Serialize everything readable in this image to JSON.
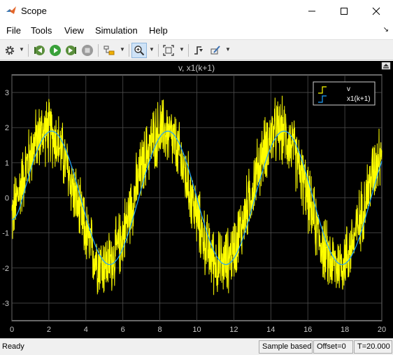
{
  "window": {
    "title": "Scope",
    "controls": [
      "minimize-icon",
      "maximize-icon",
      "close-icon"
    ]
  },
  "menu": {
    "items": [
      "File",
      "Tools",
      "View",
      "Simulation",
      "Help"
    ]
  },
  "toolbar": {
    "icons": [
      "gear-icon",
      "step-back-icon",
      "run-icon",
      "step-forward-icon",
      "stop-icon",
      "highlight-icon",
      "zoom-in-icon",
      "fit-to-view-icon",
      "triggers-icon",
      "brush-icon"
    ]
  },
  "chart_data": {
    "type": "line",
    "title": "v, x1(k+1)",
    "xlim": [
      0,
      20
    ],
    "ylim": [
      -3.5,
      3.5
    ],
    "x_ticks": [
      "0",
      "2",
      "4",
      "6",
      "8",
      "10",
      "12",
      "14",
      "16",
      "18",
      "20"
    ],
    "y_ticks": [
      "3",
      "2",
      "1",
      "0",
      "-1",
      "-2",
      "-3"
    ],
    "grid": true,
    "legend_position": "top-right",
    "background": "#000000",
    "series": [
      {
        "name": "v",
        "color": "#ffff00",
        "description_values": {
          "amplitude": 1.9,
          "period": 6.28,
          "noise_band": 0.7
        }
      },
      {
        "name": "x1(k+1)",
        "color": "#1fa3ff",
        "description_values": {
          "amplitude": 1.9,
          "period": 6.28
        }
      }
    ]
  },
  "status": {
    "ready": "Ready",
    "sample_mode": "Sample based",
    "offset": "Offset=0",
    "time": "T=20.000"
  }
}
